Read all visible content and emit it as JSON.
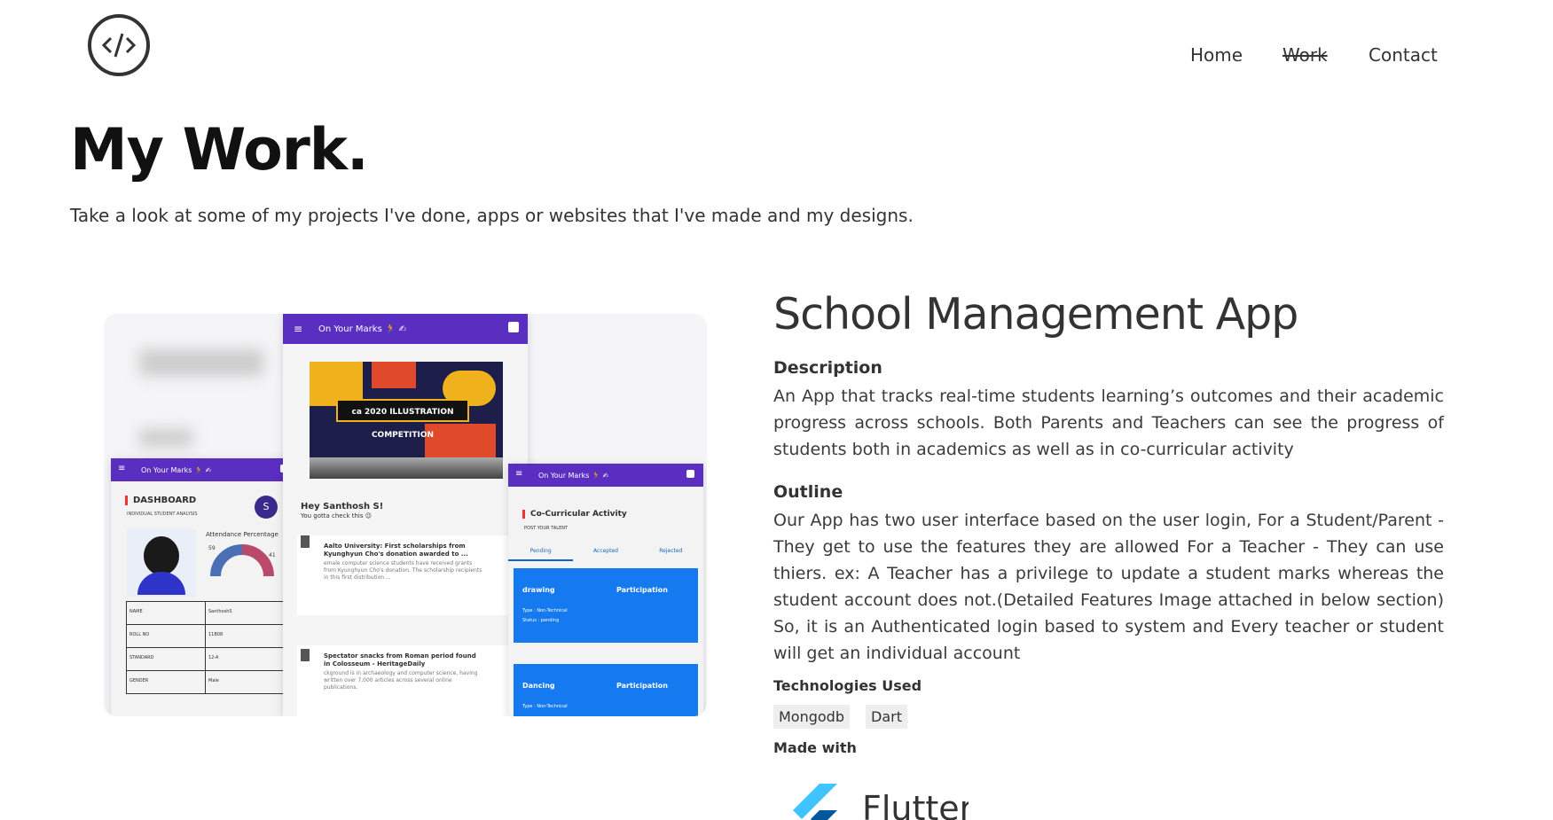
{
  "nav": {
    "home": "Home",
    "work": "Work",
    "contact": "Contact"
  },
  "hero": {
    "title": "My Work.",
    "intro": "Take a look at some of my projects I've done, apps or websites that I've made and my designs."
  },
  "project": {
    "title": "School Management App",
    "description_label": "Description",
    "description": "An App that tracks real-time students learning’s outcomes and their academic progress across schools. Both Parents and Teachers can see the progress of students both in academics as well as in co-curricular activity",
    "outline_label": "Outline",
    "outline": "Our App has two user interface based on the user login, For a Student/Parent - They get to use the features they are allowed For a Teacher - They can use thiers. ex: A Teacher has a privilege to update a student marks whereas the student account does not.(Detailed Features Image attached in below section) So, it is an Authenticated login based to system and Every teacher or student will get an individual account",
    "technologies_label": "Technologies Used",
    "technologies": [
      "Mongodb",
      "Dart"
    ],
    "made_with_label": "Made with",
    "made_with": "Flutter"
  },
  "mockup": {
    "app_title": "On Your Marks 🏃 ✍",
    "dashboard": "DASHBOARD",
    "dashboard_sub": "INDIVIDUAL STUDENT ANALYSIS",
    "avatar_letter": "S",
    "attendance": "Attendance Percentage",
    "attendance_values": [
      "59",
      "41"
    ],
    "table": [
      [
        "NAME",
        "SanthoshS"
      ],
      [
        "ROLL NO",
        "11B08"
      ],
      [
        "STANDARD",
        "12-A"
      ],
      [
        "GENDER",
        "Male"
      ]
    ],
    "greeting": "Hey Santhosh S!",
    "greeting_sub": "You gotta check this 😉",
    "poster": "ca 2020 ILLUSTRATION COMPETITION",
    "news1_title": "Aalto University: First scholarships from Kyunghyun Cho's donation awarded to ...",
    "news1_body": "emale computer science students have received grants from Kyunghyun Cho's donation. The scholarship recipients in this first distribution ...",
    "news2_title": "Spectator snacks from Roman period found in Colosseum - HeritageDaily",
    "news2_body": "ckground is in archaeology and computer science, having written over 7,000 articles across several online publications.",
    "cc_title": "Co-Curricular Activity",
    "cc_sub": "POST YOUR TALENT",
    "tabs": [
      "Pending",
      "Accepted",
      "Rejected"
    ],
    "card1": {
      "name": "drawing",
      "tag": "Participation",
      "type": "Type : Non-Technical",
      "status": "Status : pending"
    },
    "card2": {
      "name": "Dancing",
      "tag": "Participation",
      "type": "Type : Non-Technical"
    }
  }
}
